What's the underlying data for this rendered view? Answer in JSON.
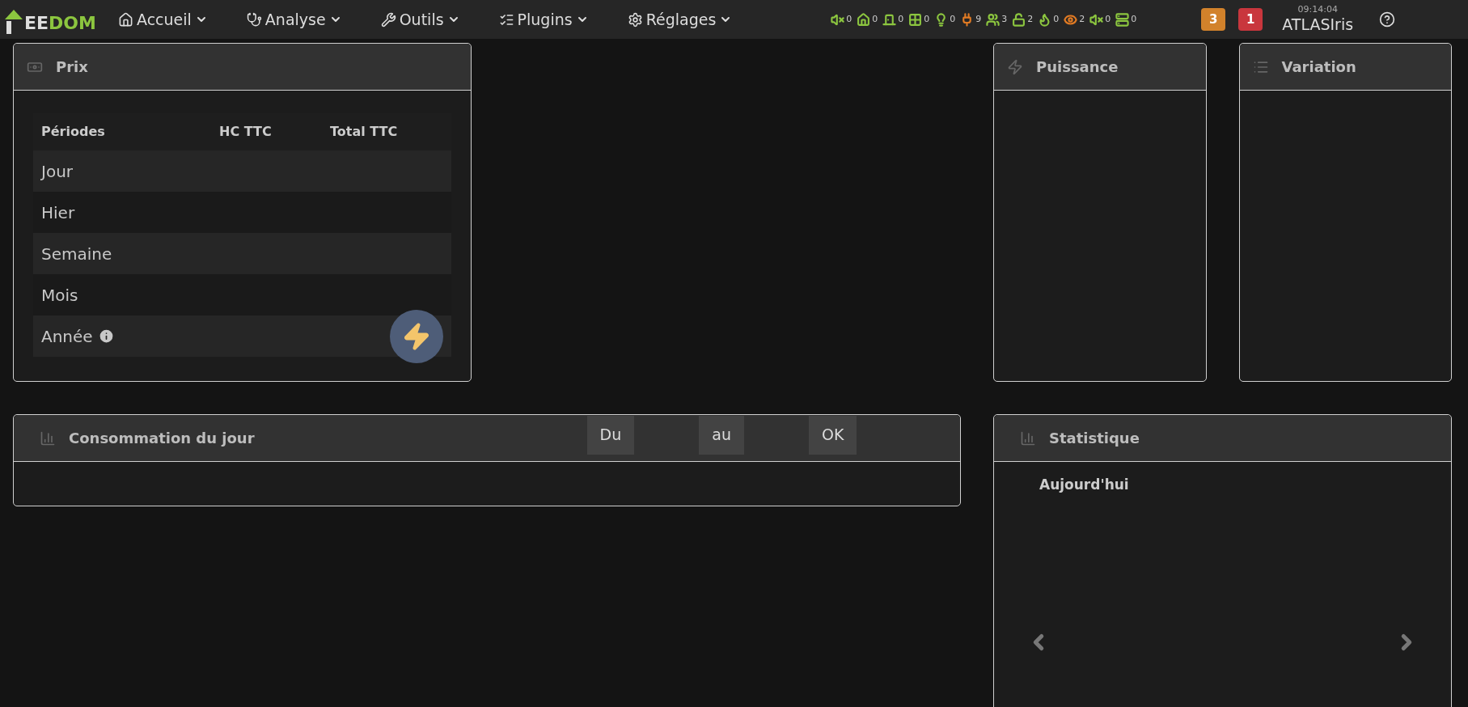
{
  "navbar": {
    "logo": "EEDOM",
    "menus": [
      {
        "label": "Accueil"
      },
      {
        "label": "Analyse"
      },
      {
        "label": "Outils"
      },
      {
        "label": "Plugins"
      },
      {
        "label": "Réglages"
      }
    ],
    "summary": [
      {
        "kind": "mute",
        "count": "0",
        "color": "#8cc63f"
      },
      {
        "kind": "house",
        "count": "0",
        "color": "#8cc63f"
      },
      {
        "kind": "door",
        "count": "0",
        "color": "#8cc63f"
      },
      {
        "kind": "window",
        "count": "0",
        "color": "#8cc63f"
      },
      {
        "kind": "bulb",
        "count": "0",
        "color": "#8cc63f"
      },
      {
        "kind": "plug",
        "count": "9",
        "color": "#e07a23"
      },
      {
        "kind": "people",
        "count": "3",
        "color": "#8cc63f"
      },
      {
        "kind": "lock",
        "count": "2",
        "color": "#8cc63f"
      },
      {
        "kind": "flame",
        "count": "0",
        "color": "#8cc63f"
      },
      {
        "kind": "eye",
        "count": "2",
        "color": "#e07a23"
      },
      {
        "kind": "speaker",
        "count": "0",
        "color": "#8cc63f"
      },
      {
        "kind": "server",
        "count": "0",
        "color": "#8cc63f"
      }
    ],
    "badges": [
      {
        "count": "3",
        "color": "#d2822b"
      },
      {
        "count": "1",
        "color": "#c9363d"
      }
    ],
    "time": "09:14:04",
    "user": "ATLASIris"
  },
  "prix": {
    "title": "Prix",
    "columns": [
      "Périodes",
      "HC TTC",
      "Total TTC"
    ],
    "rows": [
      {
        "label": "Jour",
        "info": false
      },
      {
        "label": "Hier",
        "info": false
      },
      {
        "label": "Semaine",
        "info": false
      },
      {
        "label": "Mois",
        "info": false
      },
      {
        "label": "Année",
        "info": true
      }
    ]
  },
  "puissance": {
    "title": "Puissance"
  },
  "variation": {
    "title": "Variation"
  },
  "consommation": {
    "title": "Consommation du jour",
    "buttons": [
      "Du",
      "au",
      "OK"
    ]
  },
  "statistique": {
    "title": "Statistique",
    "period": "Aujourd'hui"
  }
}
